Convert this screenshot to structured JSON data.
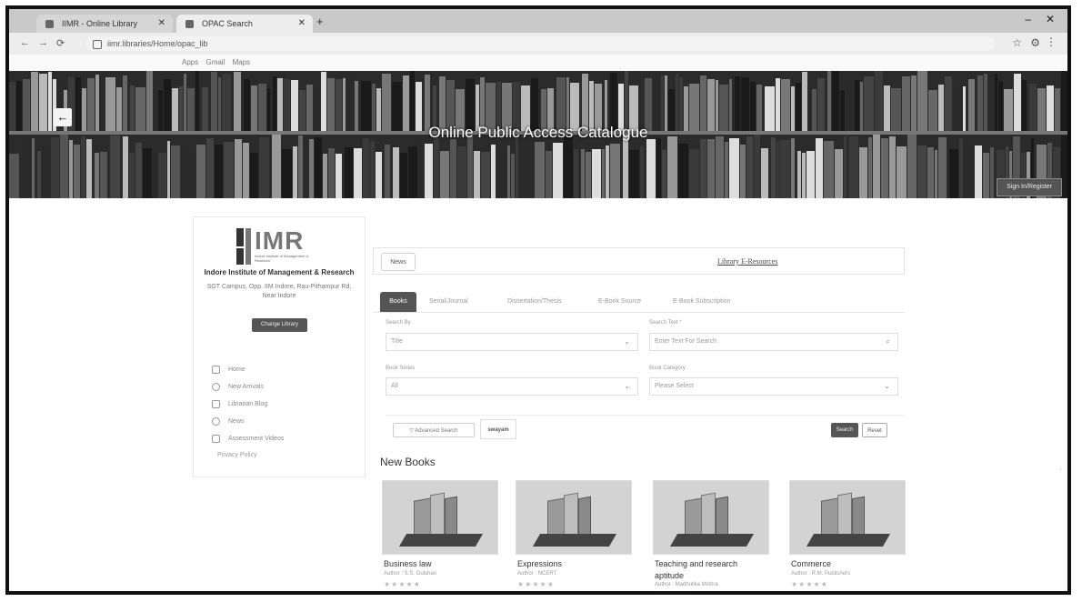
{
  "browser": {
    "tabs": [
      {
        "label": "IIMR - Online Library"
      },
      {
        "label": "OPAC Search"
      }
    ],
    "url": "iimr.libraries/Home/opac_lib",
    "bookmarks": [
      "Apps",
      "Gmail",
      "Maps"
    ]
  },
  "hero": {
    "title": "Online Public Access Catalogue",
    "signin_label": "Sign In/Register"
  },
  "institution": {
    "logo_text": "IMR",
    "logo_tagline": "Indore Institute of Management & Research",
    "name": "Indore Institute of Management & Research",
    "address": "SGT Campus, Opp. IIM Indore, Rau-Pithampur Rd, Near Indore",
    "change_library_label": "Change Library"
  },
  "menu": {
    "items": [
      {
        "label": "Home",
        "icon": "home-icon"
      },
      {
        "label": "New Arrivals",
        "icon": "new-arrivals-icon"
      },
      {
        "label": "Librarian Blog",
        "icon": "blog-icon"
      },
      {
        "label": "News",
        "icon": "news-icon"
      },
      {
        "label": "Assessment Videos",
        "icon": "video-icon"
      }
    ],
    "privacy_label": "Privacy Policy"
  },
  "news": {
    "button_label": "News",
    "eresources_label": "Library E-Resources"
  },
  "search_tabs": [
    "Books",
    "Serial/Journal",
    "Dissertation/Thesis",
    "E-Book Source",
    "E-Book Subscription"
  ],
  "search_form": {
    "search_by_label": "Search By",
    "search_by_value": "Title",
    "search_text_label": "Search Text *",
    "search_text_placeholder": "Enter Text For Search",
    "book_series_label": "Book Series",
    "book_series_value": "All",
    "book_category_label": "Book Category",
    "book_category_value": "Please Select",
    "advanced_search_label": "Advanced Search",
    "swayam_label": "swayam",
    "search_label": "Search",
    "reset_label": "Reset"
  },
  "new_books": {
    "title": "New Books",
    "books": [
      {
        "title": "Business law",
        "author": "Author : S.S. Gulshan",
        "stars": "★★★★★"
      },
      {
        "title": "Expressions",
        "author": "Author : NCERT",
        "stars": "★★★★★"
      },
      {
        "title": "Teaching and research aptitude",
        "author": "Author : Madhulika Mishra",
        "stars": "★★★★★"
      },
      {
        "title": "Commerce",
        "author": "Author : R.M. Publishers",
        "stars": "★★★★★"
      }
    ]
  },
  "colors": {
    "hero_bg": "#2b2b2b",
    "active_tab": "#555555",
    "button_dark": "#555555"
  }
}
